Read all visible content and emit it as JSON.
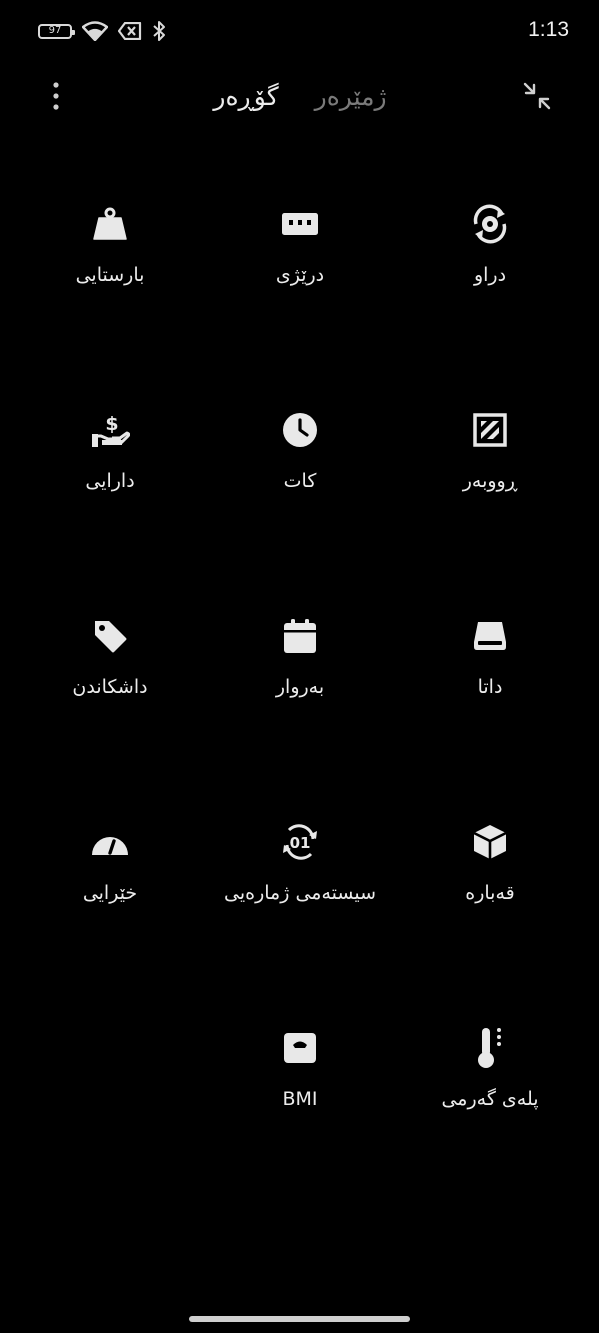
{
  "status_bar": {
    "battery": "97",
    "time": "1:13"
  },
  "header": {
    "tabs": [
      {
        "label": "گۆڕەر",
        "active": true
      },
      {
        "label": "ژمێرەر",
        "active": false
      }
    ],
    "menu_icon": "more-vertical-icon",
    "collapse_icon": "collapse-icon"
  },
  "grid": [
    {
      "label": "دراو",
      "icon": "currency-exchange-icon"
    },
    {
      "label": "درێژی",
      "icon": "ruler-icon"
    },
    {
      "label": "بارستایی",
      "icon": "weight-icon"
    },
    {
      "label": "ڕووبەر",
      "icon": "area-icon"
    },
    {
      "label": "کات",
      "icon": "clock-icon"
    },
    {
      "label": "دارایی",
      "icon": "finance-icon"
    },
    {
      "label": "داتا",
      "icon": "storage-icon"
    },
    {
      "label": "بەروار",
      "icon": "calendar-icon"
    },
    {
      "label": "داشکاندن",
      "icon": "tag-icon"
    },
    {
      "label": "قەبارە",
      "icon": "box-icon"
    },
    {
      "label": "سیستەمی ژمارەیی",
      "icon": "number-system-icon"
    },
    {
      "label": "خێرایی",
      "icon": "speedometer-icon"
    },
    {
      "label": "پلەی گەرمی",
      "icon": "thermometer-icon"
    },
    {
      "label": "BMI",
      "icon": "scale-icon"
    }
  ],
  "colors": {
    "background": "#000000",
    "text": "#ececec",
    "inactive_tab": "#7a7a7a"
  }
}
